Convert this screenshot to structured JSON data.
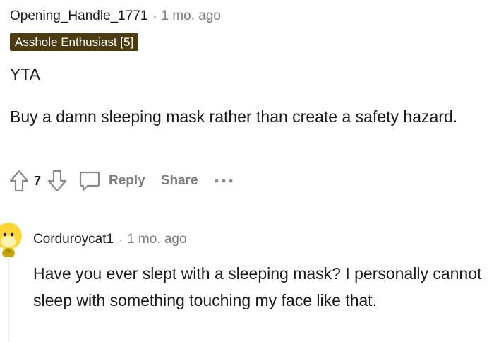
{
  "comment": {
    "username": "Opening_Handle_1771",
    "separator": "·",
    "time": "1 mo. ago",
    "flair": "Asshole Enthusiast [5]",
    "verdict": "YTA",
    "body": "Buy a damn sleeping mask rather than create a safety hazard.",
    "vote_count": "7",
    "reply_label": "Reply",
    "share_label": "Share",
    "flair_color": "#4b3b10"
  },
  "reply": {
    "username": "Corduroycat1",
    "separator": "·",
    "time": "1 mo. ago",
    "body": "Have you ever slept with a sleeping mask? I personally cannot sleep with something touching my face like that.",
    "avatar_color": "#ffd635"
  },
  "icons": {
    "upvote": "upvote-arrow-icon",
    "downvote": "downvote-arrow-icon",
    "comment": "comment-bubble-icon",
    "more": "more-options-icon"
  }
}
